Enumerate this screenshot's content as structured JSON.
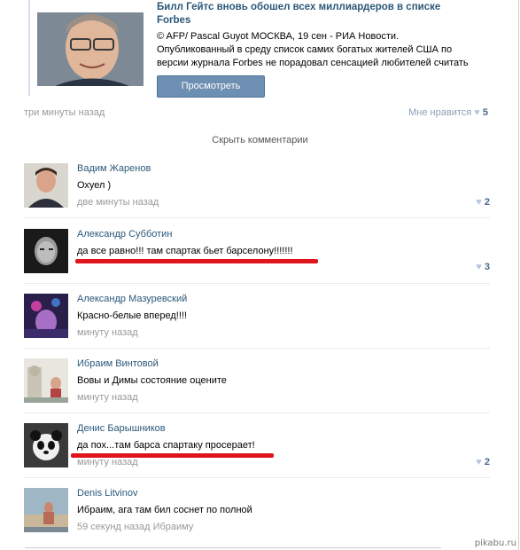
{
  "article": {
    "title": "Билл Гейтс вновь обошел всех миллиардеров в списке Forbes",
    "text": "© AFP/ Pascal Guyot МОСКВА, 19 сен - РИА Новости. Опубликованный в среду список самих богатых жителей США по версии журнала Forbes не порадовал сенсацией любителей считать",
    "view_button": "Просмотреть"
  },
  "post": {
    "time": "три минуты назад",
    "like_label": "Мне нравится",
    "like_count": "5"
  },
  "hide_comments": "Скрыть комментарии",
  "comments": [
    {
      "name": "Вадим Жаренов",
      "text": "Охуел )",
      "meta": "две минуты назад",
      "likes": "2"
    },
    {
      "name": "Александр Субботин",
      "text": "да все равно!!! там спартак бьет барселону!!!!!!!",
      "meta": "",
      "likes": "3"
    },
    {
      "name": "Александр Мазуревский",
      "text": "Красно-белые вперед!!!!",
      "meta": "минуту назад",
      "likes": ""
    },
    {
      "name": "Ибраим Винтовой",
      "text": "Вовы и Димы состояние оцените",
      "meta": "минуту назад",
      "likes": ""
    },
    {
      "name": "Денис Барышников",
      "text": "да пох...там барса спартаку просерает!",
      "meta": "минуту назад",
      "likes": "2"
    },
    {
      "name": "Denis Litvinov",
      "text": "Ибраим, ага там бил соснет по полной",
      "meta": "59 секунд назад Ибраиму",
      "likes": ""
    }
  ],
  "watermark": "pikabu.ru",
  "colors": {
    "link": "#2b587a",
    "button": "#6d8fb3",
    "underline": "#e0141c",
    "heart": "#b6c6d8"
  }
}
